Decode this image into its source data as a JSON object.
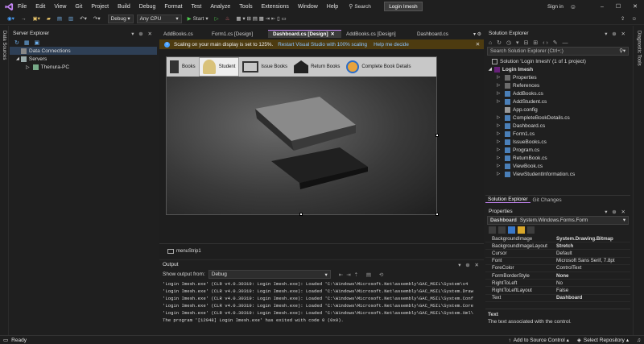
{
  "menu": [
    "File",
    "Edit",
    "View",
    "Git",
    "Project",
    "Build",
    "Debug",
    "Format",
    "Test",
    "Analyze",
    "Tools",
    "Extensions",
    "Window",
    "Help"
  ],
  "search_label": "Search",
  "solution_name": "Login Imesh",
  "account": {
    "label": "Sign in"
  },
  "toolbar": {
    "config": "Debug",
    "platform": "Any CPU",
    "start": "Start"
  },
  "left_vertical_tab": "Data Sources",
  "right_vertical_tab": "Diagnostic Tools",
  "server_explorer": {
    "title": "Server Explorer",
    "items": [
      "Data Connections",
      "Servers",
      "Thenura-PC"
    ]
  },
  "doc_tabs": [
    "AddBooks.cs",
    "Form1.cs [Design]",
    "Dashboard.cs [Design]",
    "AddBooks.cs [Design]",
    "Dashboard.cs"
  ],
  "infobar": {
    "message": "Scaling on your main display is set to 125%.",
    "link1": "Restart Visual Studio with 100% scaling",
    "link2": "Help me decide"
  },
  "form_nav": [
    "Books",
    "Student",
    "Issue Books",
    "Return Books",
    "Complete Book Details"
  ],
  "tray": "menuStrip1",
  "output": {
    "title": "Output",
    "show_from_label": "Show output from:",
    "source": "Debug",
    "lines": [
      "'Login Imesh.exe' (CLR v4.0.30319: Login Imesh.exe): Loaded 'C:\\Windows\\Microsoft.Net\\assembly\\GAC_MSIL\\System\\v4",
      "'Login Imesh.exe' (CLR v4.0.30319: Login Imesh.exe): Loaded 'C:\\Windows\\Microsoft.Net\\assembly\\GAC_MSIL\\System.Draw",
      "'Login Imesh.exe' (CLR v4.0.30319: Login Imesh.exe): Loaded 'C:\\Windows\\Microsoft.Net\\assembly\\GAC_MSIL\\System.Conf",
      "'Login Imesh.exe' (CLR v4.0.30319: Login Imesh.exe): Loaded 'C:\\Windows\\Microsoft.Net\\assembly\\GAC_MSIL\\System.Core",
      "'Login Imesh.exe' (CLR v4.0.30319: Login Imesh.exe): Loaded 'C:\\Windows\\Microsoft.Net\\assembly\\GAC_MSIL\\System.Xml\\",
      "The program '[12948] Login Imesh.exe' has exited with code 0 (0x0)."
    ]
  },
  "solution_explorer": {
    "title": "Solution Explorer",
    "search_placeholder": "Search Solution Explorer (Ctrl+;)",
    "solution_label": "Solution 'Login Imesh' (1 of 1 project)",
    "project": "Login Imesh",
    "items": [
      "Properties",
      "References",
      "AddBooks.cs",
      "AddStudent.cs",
      "App.config",
      "CompleteBookDetails.cs",
      "Dashboard.cs",
      "Form1.cs",
      "IssueBooks.cs",
      "Program.cs",
      "ReturnBook.cs",
      "ViewBook.cs",
      "ViewStudentInformation.cs"
    ],
    "tabs": [
      "Solution Explorer",
      "Git Changes"
    ]
  },
  "properties": {
    "title": "Properties",
    "object_name": "Dashboard",
    "object_type": "System.Windows.Forms.Form",
    "rows": [
      {
        "name": "BackgroundImage",
        "value": "System.Drawing.Bitmap"
      },
      {
        "name": "BackgroundImageLayout",
        "value": "Stretch"
      },
      {
        "name": "Cursor",
        "value": "Default"
      },
      {
        "name": "Font",
        "value": "Microsoft Sans Serif, 7.8pt"
      },
      {
        "name": "ForeColor",
        "value": "ControlText"
      },
      {
        "name": "FormBorderStyle",
        "value": "None"
      },
      {
        "name": "RightToLeft",
        "value": "No"
      },
      {
        "name": "RightToLeftLayout",
        "value": "False"
      },
      {
        "name": "Text",
        "value": "Dashboard"
      }
    ],
    "desc_title": "Text",
    "desc_body": "The text associated with the control."
  },
  "status": {
    "ready": "Ready",
    "source_control": "Add to Source Control",
    "repository": "Select Repository"
  },
  "colors": {
    "accent": "#007acc",
    "infobar": "#4d3b10",
    "statusbar": "#1f1f1f",
    "purple": "#68217a"
  }
}
